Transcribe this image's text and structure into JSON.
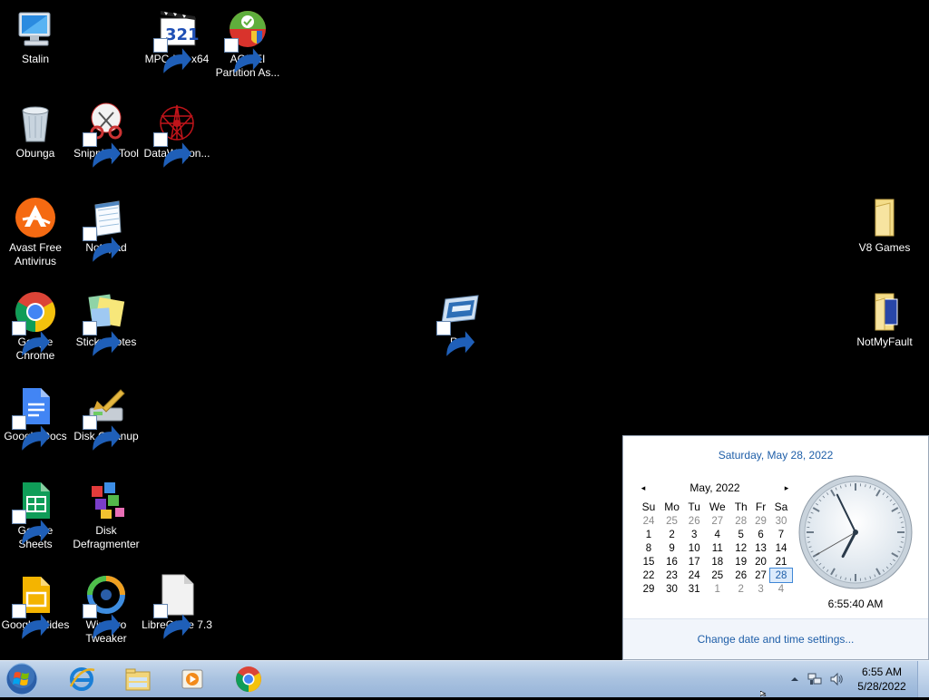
{
  "desktop": {
    "icons": [
      {
        "id": "stalin",
        "label": "Stalin"
      },
      {
        "id": "mpc",
        "label": "MPC-HC x64"
      },
      {
        "id": "aomei",
        "label": "AOMEI Partition As..."
      },
      {
        "id": "obunga",
        "label": "Obunga"
      },
      {
        "id": "snipping",
        "label": "Snipping Tool"
      },
      {
        "id": "datawagon",
        "label": "DataWagon..."
      },
      {
        "id": "avast",
        "label": "Avast Free Antivirus"
      },
      {
        "id": "notepad",
        "label": "Notepad"
      },
      {
        "id": "v8games",
        "label": "V8 Games"
      },
      {
        "id": "chrome",
        "label": "Google Chrome"
      },
      {
        "id": "stickynotes",
        "label": "Sticky Notes"
      },
      {
        "id": "run",
        "label": "Run"
      },
      {
        "id": "notmyfault",
        "label": "NotMyFault"
      },
      {
        "id": "docs",
        "label": "Google Docs"
      },
      {
        "id": "diskcleanup",
        "label": "Disk Cleanup"
      },
      {
        "id": "sheets",
        "label": "Google Sheets"
      },
      {
        "id": "defrag",
        "label": "Disk Defragmenter"
      },
      {
        "id": "slides",
        "label": "Google Slides"
      },
      {
        "id": "winaero",
        "label": "Winaero Tweaker"
      },
      {
        "id": "libreoffice",
        "label": "LibreOffice 7.3"
      }
    ]
  },
  "flyout": {
    "full_date": "Saturday, May 28, 2022",
    "month_label": "May, 2022",
    "prev_symbol": "◂",
    "next_symbol": "▸",
    "weekdays": [
      "Su",
      "Mo",
      "Tu",
      "We",
      "Th",
      "Fr",
      "Sa"
    ],
    "weeks": [
      [
        "24",
        "25",
        "26",
        "27",
        "28",
        "29",
        "30"
      ],
      [
        "1",
        "2",
        "3",
        "4",
        "5",
        "6",
        "7"
      ],
      [
        "8",
        "9",
        "10",
        "11",
        "12",
        "13",
        "14"
      ],
      [
        "15",
        "16",
        "17",
        "18",
        "19",
        "20",
        "21"
      ],
      [
        "22",
        "23",
        "24",
        "25",
        "26",
        "27",
        "28"
      ],
      [
        "29",
        "30",
        "31",
        "1",
        "2",
        "3",
        "4"
      ]
    ],
    "clock_time": "6:55:40 AM",
    "clock_hour": 6,
    "clock_minute": 55,
    "clock_second": 40,
    "settings_link": "Change date and time settings..."
  },
  "taskbar": {
    "time": "6:55 AM",
    "date": "5/28/2022",
    "pinned": [
      "internet-explorer-icon",
      "file-explorer-icon",
      "media-player-icon",
      "chrome-icon"
    ],
    "tray": [
      "show-hidden-icons-icon",
      "network-icon",
      "volume-icon"
    ]
  },
  "colors": {
    "desktop_bg": "#000000",
    "link_blue": "#1e5ea8",
    "taskbar_blue": "#a9c2e0"
  }
}
